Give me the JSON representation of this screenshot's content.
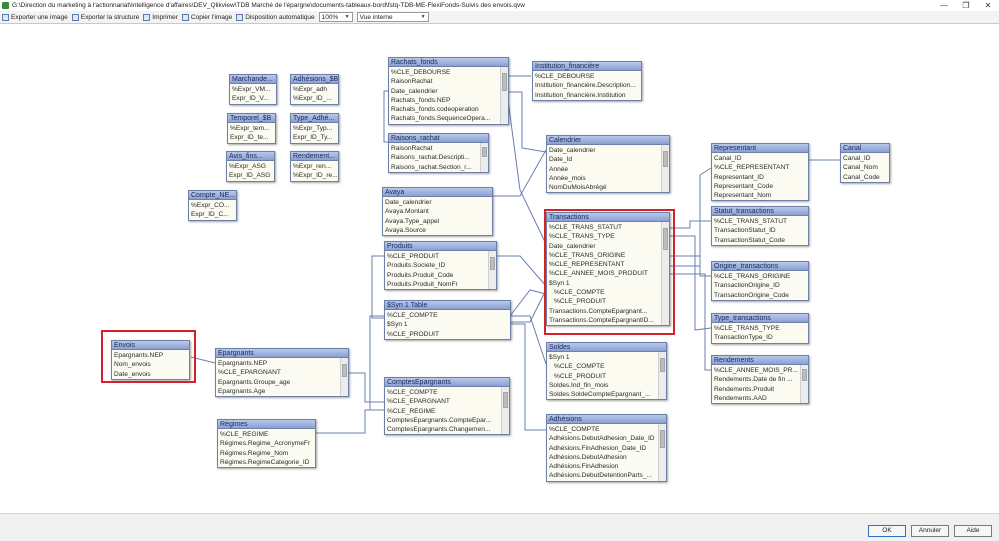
{
  "window": {
    "title": "G:\\Direction du marketing à l'actionnariat\\Intelligence d'affaires\\DEV_Qlikview\\TDB Marché de l'épargne\\documents-tableaux-bord\\fstq-TDB-ME-FlexiFonds-Suivis des envois.qvw",
    "minimize": "—",
    "restore": "❐",
    "close": "✕"
  },
  "toolbar": {
    "export_image": "Exporter une image",
    "export_structure": "Exporter la structure",
    "print": "Imprimer",
    "copy_image": "Copier l'image",
    "auto_layout": "Disposition automatique",
    "zoom": "100%",
    "view": "Vue interne"
  },
  "footer": {
    "ok": "OK",
    "cancel": "Annuler",
    "help": "Aide"
  },
  "tables": {
    "marchande": {
      "title": "Marchande...",
      "fields": [
        "%Expr_VM...",
        "Expr_ID_V..."
      ]
    },
    "adhesions_sb": {
      "title": "Adhésions_$B",
      "fields": [
        "%Expr_adh",
        "%Expr_ID_..."
      ]
    },
    "temporel": {
      "title": "Temporel_$B",
      "fields": [
        "%Expr_tem...",
        "Expr_ID_te..."
      ]
    },
    "type_adh": {
      "title": "Type_Adhé...",
      "fields": [
        "%Expr_Typ...",
        "Expr_ID_Ty..."
      ]
    },
    "avis": {
      "title": "Avis_fins...",
      "fields": [
        "%Expr_ASG",
        "Expr_ID_ASG"
      ]
    },
    "rendement_sb": {
      "title": "Rendement...",
      "fields": [
        "%Expr_ren...",
        "%Expr_ID_re..."
      ]
    },
    "compte_ne": {
      "title": "Compte_NE...",
      "fields": [
        "%Expr_CO...",
        "Expr_ID_C..."
      ]
    },
    "rachats": {
      "title": "Rachats_fonds",
      "fields": [
        "%CLE_DEBOURSE",
        "RaisonRachat",
        "Date_calendrier",
        "Rachats_fonds.NEP",
        "Rachats_fonds.codeoperation",
        "Rachats_fonds.SequenceOpera..."
      ]
    },
    "raisons": {
      "title": "Raisons_rachat",
      "fields": [
        "RaisonRachat",
        "Raisons_rachat.Descripti...",
        "Raisons_rachat.Section_r..."
      ]
    },
    "institution": {
      "title": "Institution_financière",
      "fields": [
        "%CLE_DEBOURSE",
        "Institution_financière.Description...",
        "Institution_financière.Institution"
      ]
    },
    "calendrier": {
      "title": "Calendrier",
      "fields": [
        "Date_calendrier",
        "Date_Id",
        "Année",
        "Année_mois",
        "NomDuMoisAbrégé"
      ]
    },
    "avaya": {
      "title": "Avaya",
      "fields": [
        "Date_calendrier",
        "Avaya.Montant",
        "Avaya.Type_appel",
        "Avaya.Source"
      ]
    },
    "produits": {
      "title": "Produits",
      "fields": [
        "%CLE_PRODUIT",
        "Produits.Societe_ID",
        "Produits.Produit_Code",
        "Produits.Produit_NomFr"
      ]
    },
    "syn1": {
      "title": "$Syn 1 Table",
      "fields": [
        "%CLE_COMPTE",
        "$Syn 1",
        "%CLE_PRODUIT"
      ]
    },
    "transactions": {
      "title": "Transactions",
      "fields": [
        "%CLE_TRANS_STATUT",
        "%CLE_TRANS_TYPE",
        "Date_calendrier",
        "%CLE_TRANS_ORIGINE",
        "%CLE_REPRESENTANT",
        "%CLE_ANNEE_MOIS_PRODUIT",
        "$Syn 1",
        "%CLE_COMPTE",
        "%CLE_PRODUIT",
        "Transactions.CompteEpargnant...",
        "Transactions.CompteEpargnantID..."
      ]
    },
    "representant": {
      "title": "Representant",
      "fields": [
        "Canal_ID",
        "%CLE_REPRESENTANT",
        "Representant_ID",
        "Representant_Code",
        "Representant_Nom"
      ]
    },
    "canal": {
      "title": "Canal",
      "fields": [
        "Canal_ID",
        "Canal_Nom",
        "Canal_Code"
      ]
    },
    "statut": {
      "title": "Statut_transactions",
      "fields": [
        "%CLE_TRANS_STATUT",
        "TransactionStatut_ID",
        "TransactionStatut_Code"
      ]
    },
    "origine": {
      "title": "Origine_transactions",
      "fields": [
        "%CLE_TRANS_ORIGINE",
        "TransactionOrigine_ID",
        "TransactionOrigine_Code"
      ]
    },
    "type_trans": {
      "title": "Type_transactions",
      "fields": [
        "%CLE_TRANS_TYPE",
        "TransactionType_ID"
      ]
    },
    "rendements": {
      "title": "Rendements",
      "fields": [
        "%CLE_ANNEE_MOIS_PR...",
        "Rendements.Date de fin ...",
        "Rendements.Produit",
        "Rendements.AAD"
      ]
    },
    "envois": {
      "title": "Envois",
      "fields": [
        "Epargnants.NEP",
        "Nom_envois",
        "Date_envois"
      ]
    },
    "epargnants": {
      "title": "Epargnants",
      "fields": [
        "Epargnants.NEP",
        "%CLE_EPARGNANT",
        "Epargnants.Groupe_age",
        "Epargnants.Age"
      ]
    },
    "comptes": {
      "title": "ComptesEpargnants",
      "fields": [
        "%CLE_COMPTE",
        "%CLE_EPARGNANT",
        "%CLE_REGIME",
        "ComptesEpargnants.CompteEpar...",
        "ComptesEpargnants.Changemen..."
      ]
    },
    "regimes": {
      "title": "Régimes",
      "fields": [
        "%CLE_REGIME",
        "Régimes.Regime_AcronymeFr",
        "Régimes.Regime_Nom",
        "Régimes.RegimeCategorie_ID"
      ]
    },
    "soldes": {
      "title": "Soldes",
      "fields": [
        "$Syn 1",
        "%CLE_COMPTE",
        "%CLE_PRODUIT",
        "Soldes.Ind_fin_mois",
        "Soldes.SoldeCompteEpargnant_..."
      ]
    },
    "adhesions": {
      "title": "Adhésions",
      "fields": [
        "%CLE_COMPTE",
        "Adhésions.DebutAdhesion_Date_ID",
        "Adhésions.FinAdhesion_Date_ID",
        "Adhésions.DebutAdhesion",
        "Adhésions.FinAdhesion",
        "Adhésions.DebutDetentionParts_..."
      ]
    }
  }
}
